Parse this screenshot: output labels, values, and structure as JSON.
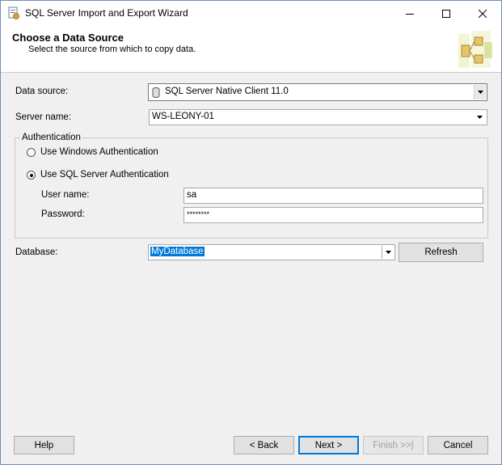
{
  "window": {
    "title": "SQL Server Import and Export Wizard"
  },
  "header": {
    "title": "Choose a Data Source",
    "subtitle": "Select the source from which to copy data."
  },
  "form": {
    "data_source_label": "Data source:",
    "data_source_value": "SQL Server Native Client 11.0",
    "server_name_label": "Server name:",
    "server_name_value": "WS-LEONY-01",
    "auth_group_label": "Authentication",
    "windows_auth_label": "Use Windows Authentication",
    "sql_auth_label": "Use SQL Server Authentication",
    "selected_auth": "sql",
    "user_name_label": "User name:",
    "user_name_value": "sa",
    "password_label": "Password:",
    "password_value": "********",
    "database_label": "Database:",
    "database_value": "MyDatabase",
    "refresh_label": "Refresh"
  },
  "footer": {
    "help_label": "Help",
    "back_label": "< Back",
    "next_label": "Next >",
    "finish_label": "Finish >>|",
    "cancel_label": "Cancel"
  },
  "colors": {
    "selection": "#0078d7",
    "window_bg": "#f0f0f0"
  }
}
